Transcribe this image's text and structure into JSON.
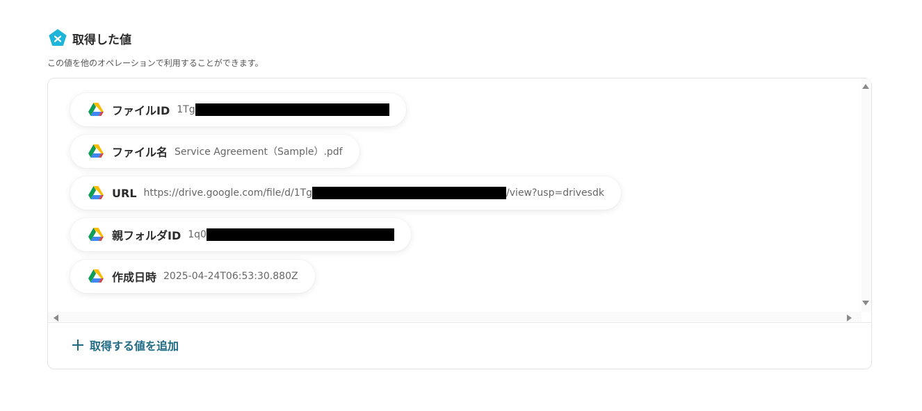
{
  "header": {
    "title": "取得した値",
    "icon": "yoom-logo-icon",
    "icon_color": "#1fb5d9"
  },
  "description": "この値を他のオペレーションで利用することができます。",
  "fields": [
    {
      "label": "ファイルID",
      "value_prefix": "1Tg",
      "value_suffix": "",
      "icon": "google-drive-icon"
    },
    {
      "label": "ファイル名",
      "value_prefix": "Service Agreement（Sample）.pdf",
      "value_suffix": "",
      "icon": "google-drive-icon"
    },
    {
      "label": "URL",
      "value_prefix": "https://drive.google.com/file/d/1Tg",
      "value_suffix": "/view?usp=drivesdk",
      "icon": "google-drive-icon"
    },
    {
      "label": "親フォルダID",
      "value_prefix": "1q0",
      "value_suffix": "",
      "icon": "google-drive-icon"
    },
    {
      "label": "作成日時",
      "value_prefix": "2025-04-24T06:53:30.880Z",
      "value_suffix": "",
      "icon": "google-drive-icon"
    }
  ],
  "add_button": {
    "label": "取得する値を追加",
    "color": "#1f6a84"
  }
}
